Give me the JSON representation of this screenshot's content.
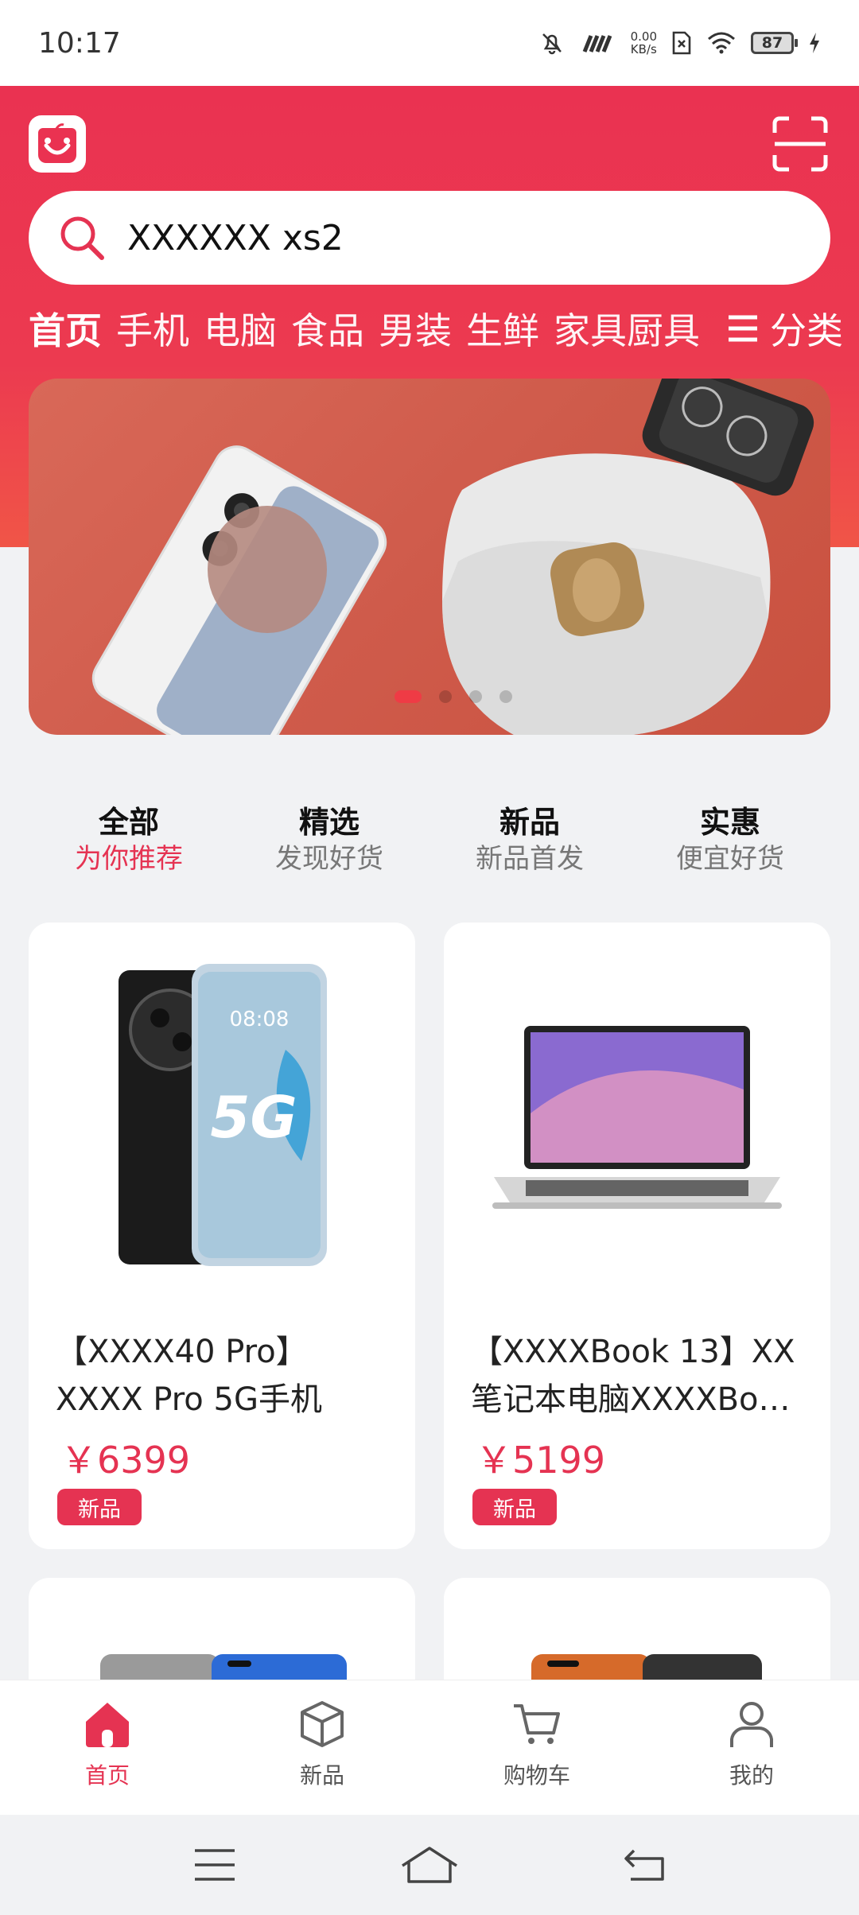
{
  "status_bar": {
    "time": "10:17",
    "speed_value": "0.00",
    "speed_unit": "KB/s",
    "battery": "87"
  },
  "header": {
    "search_text": "XXXXXX xs2",
    "categories": [
      "首页",
      "手机",
      "电脑",
      "食品",
      "男装",
      "生鲜",
      "家具厨具"
    ],
    "all_categories_label": "分类"
  },
  "banner": {
    "dot_count": 4,
    "active_dot": 0
  },
  "tabs": [
    {
      "title": "全部",
      "subtitle": "为你推荐"
    },
    {
      "title": "精选",
      "subtitle": "发现好货"
    },
    {
      "title": "新品",
      "subtitle": "新品首发"
    },
    {
      "title": "实惠",
      "subtitle": "便宜好货"
    }
  ],
  "products": [
    {
      "title_line1": "【XXXX40 Pro】",
      "title_line2": "XXXX Pro 5G手机",
      "price": "￥6399",
      "badge": "新品",
      "phone_time": "08:08",
      "phone_label": "5G"
    },
    {
      "title_line1": "【XXXXBook 13】XX",
      "title_line2": "笔记本电脑XXXXBo…",
      "price": "￥5199",
      "badge": "新品"
    }
  ],
  "bottom_nav": [
    {
      "label": "首页"
    },
    {
      "label": "新品"
    },
    {
      "label": "购物车"
    },
    {
      "label": "我的"
    }
  ],
  "colors": {
    "accent": "#e53352",
    "header_red": "#ea3251"
  }
}
